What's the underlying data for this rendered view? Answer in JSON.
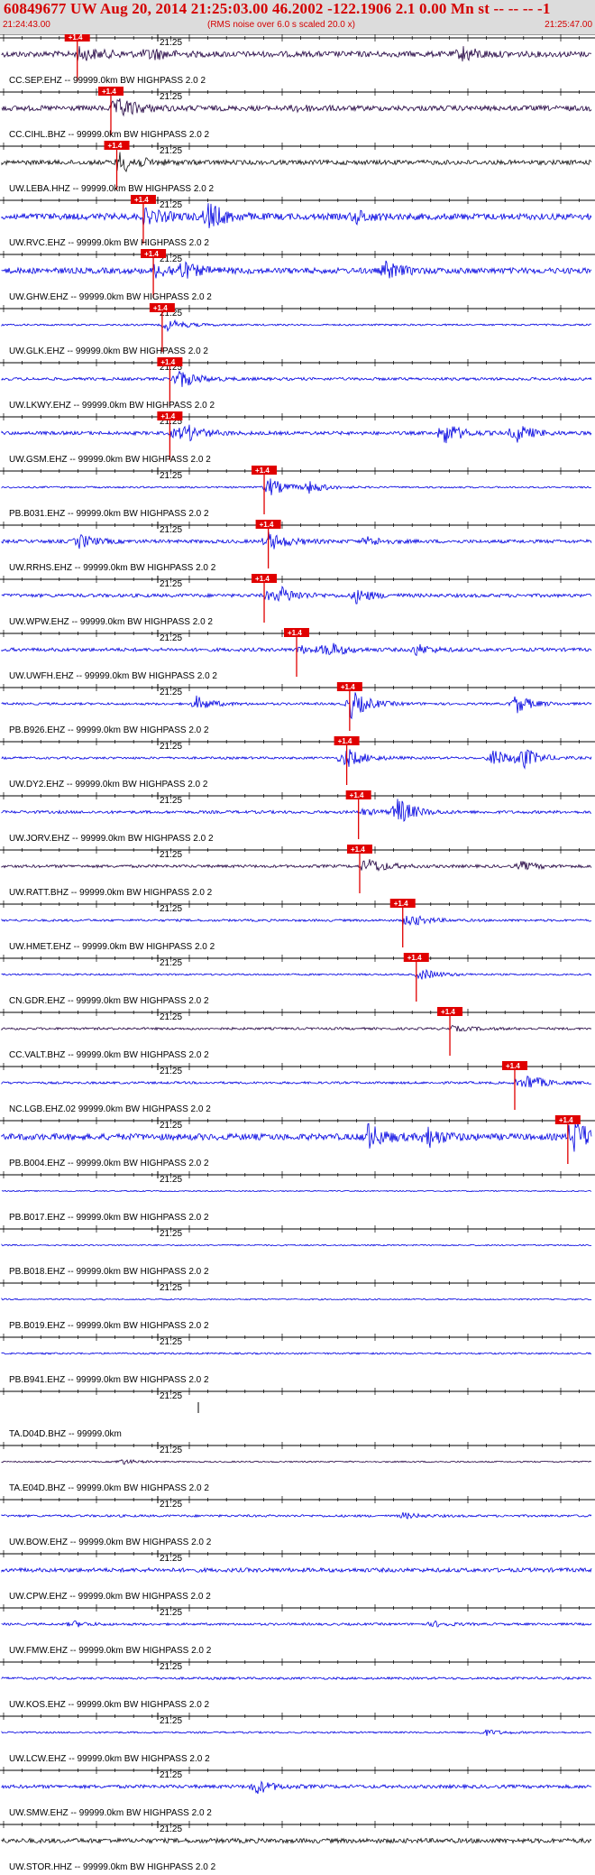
{
  "header": {
    "title": "60849677 UW Aug 20, 2014 21:25:03.00   46.2002 -122.1906  2.1 0.00 Mn st -- -- --  -1",
    "time_start": "21:24:43.00",
    "time_end": "21:25:47.00",
    "subtitle": "(RMS noise over 6.0 s scaled 20.0 x)"
  },
  "colors": {
    "trace_blue": "#0000e0",
    "trace_dark": "#200040",
    "pick_red": "#e00000",
    "header_red": "#d40000"
  },
  "minute_label": "21:25",
  "pick_label": "+1.4",
  "traces": [
    {
      "station": "CC.SEP.EHZ -- 99999.0km BW  HIGHPASS  2.0  2",
      "pick": 0.128,
      "color": "dark",
      "amp": 0.5,
      "events": [
        [
          0.25,
          0.4
        ],
        [
          0.78,
          0.5
        ]
      ]
    },
    {
      "station": "CC.CIHL.BHZ -- 99999.0km BW  HIGHPASS  2.0  2",
      "pick": 0.185,
      "color": "dark",
      "amp": 0.45,
      "events": [
        [
          0.2,
          0.4
        ],
        [
          0.5,
          0.2
        ]
      ]
    },
    {
      "station": "UW.LEBA.HHZ -- 99999.0km BW  HIGHPASS  2.0  2",
      "pick": 0.195,
      "color": "black",
      "amp": 0.4,
      "events": [
        [
          0.2,
          0.4
        ]
      ]
    },
    {
      "station": "UW.RVC.EHZ -- 99999.0km BW  HIGHPASS  2.0  2",
      "pick": 0.24,
      "color": "blue",
      "amp": 0.55,
      "events": [
        [
          0.35,
          0.9
        ],
        [
          0.6,
          0.4
        ]
      ]
    },
    {
      "station": "UW.GHW.EHZ -- 99999.0km BW  HIGHPASS  2.0  2",
      "pick": 0.257,
      "color": "blue",
      "amp": 0.5,
      "events": [
        [
          0.3,
          0.5
        ],
        [
          0.65,
          0.6
        ]
      ]
    },
    {
      "station": "UW.GLK.EHZ -- 99999.0km BW  HIGHPASS  2.0  2",
      "pick": 0.272,
      "color": "blue",
      "amp": 0.15,
      "events": [
        [
          0.28,
          0.3
        ]
      ]
    },
    {
      "station": "UW.LKWY.EHZ -- 99999.0km BW  HIGHPASS  2.0  2",
      "pick": 0.285,
      "color": "blue",
      "amp": 0.25,
      "events": [
        [
          0.3,
          0.5
        ]
      ]
    },
    {
      "station": "UW.GSM.EHZ -- 99999.0km BW  HIGHPASS  2.0  2",
      "pick": 0.285,
      "color": "blue",
      "amp": 0.3,
      "events": [
        [
          0.31,
          0.5
        ],
        [
          0.75,
          0.8
        ],
        [
          0.87,
          0.7
        ]
      ]
    },
    {
      "station": "PB.B031.EHZ -- 99999.0km BW  HIGHPASS  2.0  2",
      "pick": 0.445,
      "color": "blue",
      "amp": 0.15,
      "events": [
        [
          0.45,
          0.6
        ],
        [
          0.52,
          0.4
        ]
      ]
    },
    {
      "station": "UW.RRHS.EHZ -- 99999.0km BW  HIGHPASS  2.0  2",
      "pick": 0.452,
      "color": "blue",
      "amp": 0.3,
      "events": [
        [
          0.13,
          0.5
        ],
        [
          0.45,
          0.4
        ],
        [
          0.62,
          0.3
        ]
      ]
    },
    {
      "station": "UW.WPW.EHZ -- 99999.0km BW  HIGHPASS  2.0  2",
      "pick": 0.445,
      "color": "blue",
      "amp": 0.3,
      "events": [
        [
          0.47,
          0.5
        ],
        [
          0.6,
          0.5
        ]
      ]
    },
    {
      "station": "UW.UWFH.EHZ -- 99999.0km BW  HIGHPASS  2.0  2",
      "pick": 0.5,
      "color": "blue",
      "amp": 0.3,
      "events": [
        [
          0.55,
          0.5
        ],
        [
          0.7,
          0.4
        ]
      ]
    },
    {
      "station": "PB.B926.EHZ -- 99999.0km BW  HIGHPASS  2.0  2",
      "pick": 0.59,
      "color": "blue",
      "amp": 0.2,
      "events": [
        [
          0.33,
          0.5
        ],
        [
          0.59,
          0.9
        ],
        [
          0.87,
          0.7
        ]
      ]
    },
    {
      "station": "UW.DY2.EHZ -- 99999.0km BW  HIGHPASS  2.0  2",
      "pick": 0.585,
      "color": "blue",
      "amp": 0.2,
      "events": [
        [
          0.58,
          0.6
        ],
        [
          0.83,
          0.7
        ],
        [
          0.88,
          0.8
        ]
      ]
    },
    {
      "station": "UW.JORV.EHZ -- 99999.0km BW  HIGHPASS  2.0  2",
      "pick": 0.605,
      "color": "blue",
      "amp": 0.25,
      "events": [
        [
          0.67,
          1.0
        ]
      ]
    },
    {
      "station": "UW.RATT.BHZ -- 99999.0km BW  HIGHPASS  2.0  2",
      "pick": 0.607,
      "color": "dark",
      "amp": 0.25,
      "events": [
        [
          0.62,
          0.4
        ],
        [
          0.88,
          0.3
        ]
      ]
    },
    {
      "station": "UW.HMET.EHZ -- 99999.0km BW  HIGHPASS  2.0  2",
      "pick": 0.68,
      "color": "blue",
      "amp": 0.2,
      "events": [
        [
          0.69,
          0.3
        ]
      ]
    },
    {
      "station": "CN.GDR.EHZ -- 99999.0km BW  HIGHPASS  2.0  2",
      "pick": 0.703,
      "color": "blue",
      "amp": 0.15,
      "events": [
        [
          0.71,
          0.3
        ]
      ]
    },
    {
      "station": "CC.VALT.BHZ -- 99999.0km BW  HIGHPASS  2.0  2",
      "pick": 0.76,
      "color": "dark",
      "amp": 0.2,
      "events": []
    },
    {
      "station": "NC.LGB.EHZ.02 99999.0km BW  HIGHPASS  2.0  2",
      "pick": 0.87,
      "color": "blue",
      "amp": 0.2,
      "events": [
        [
          0.89,
          0.5
        ]
      ]
    },
    {
      "station": "PB.B004.EHZ -- 99999.0km BW  HIGHPASS  2.0  2",
      "pick": 0.96,
      "color": "blue",
      "amp": 0.55,
      "events": [
        [
          0.62,
          0.9
        ],
        [
          0.72,
          0.7
        ],
        [
          0.97,
          0.8
        ]
      ]
    },
    {
      "station": "PB.B017.EHZ -- 99999.0km BW  HIGHPASS  2.0  2",
      "pick": null,
      "color": "blue",
      "amp": 0.1,
      "events": []
    },
    {
      "station": "PB.B018.EHZ -- 99999.0km BW  HIGHPASS  2.0  2",
      "pick": null,
      "color": "blue",
      "amp": 0.12,
      "events": []
    },
    {
      "station": "PB.B019.EHZ -- 99999.0km BW  HIGHPASS  2.0  2",
      "pick": null,
      "color": "blue",
      "amp": 0.12,
      "events": []
    },
    {
      "station": "PB.B941.EHZ -- 99999.0km BW  HIGHPASS  2.0  2",
      "pick": null,
      "color": "blue",
      "amp": 0.15,
      "events": []
    },
    {
      "station": "TA.D04D.BHZ -- 99999.0km",
      "pick": null,
      "color": "blue",
      "amp": 0.0,
      "events": []
    },
    {
      "station": "TA.E04D.BHZ -- 99999.0km BW  HIGHPASS  2.0  2",
      "pick": null,
      "color": "dark",
      "amp": 0.12,
      "events": [
        [
          0.2,
          0.2
        ]
      ]
    },
    {
      "station": "UW.BOW.EHZ -- 99999.0km BW  HIGHPASS  2.0  2",
      "pick": null,
      "color": "blue",
      "amp": 0.2,
      "events": [
        [
          0.68,
          0.2
        ]
      ]
    },
    {
      "station": "UW.CPW.EHZ -- 99999.0km BW  HIGHPASS  2.0  2",
      "pick": null,
      "color": "blue",
      "amp": 0.35,
      "events": []
    },
    {
      "station": "UW.FMW.EHZ -- 99999.0km BW  HIGHPASS  2.0  2",
      "pick": null,
      "color": "blue",
      "amp": 0.2,
      "events": [
        [
          0.12,
          0.2
        ],
        [
          0.73,
          0.2
        ]
      ]
    },
    {
      "station": "UW.KOS.EHZ -- 99999.0km BW  HIGHPASS  2.0  2",
      "pick": null,
      "color": "blue",
      "amp": 0.2,
      "events": []
    },
    {
      "station": "UW.LCW.EHZ -- 99999.0km BW  HIGHPASS  2.0  2",
      "pick": null,
      "color": "blue",
      "amp": 0.15,
      "events": [
        [
          0.82,
          0.2
        ]
      ]
    },
    {
      "station": "UW.SMW.EHZ -- 99999.0km BW  HIGHPASS  2.0  2",
      "pick": null,
      "color": "blue",
      "amp": 0.3,
      "events": [
        [
          0.43,
          0.5
        ]
      ]
    },
    {
      "station": "UW.STOR.HHZ -- 99999.0km BW  HIGHPASS  2.0  2",
      "pick": null,
      "color": "black",
      "amp": 0.4,
      "events": []
    }
  ]
}
